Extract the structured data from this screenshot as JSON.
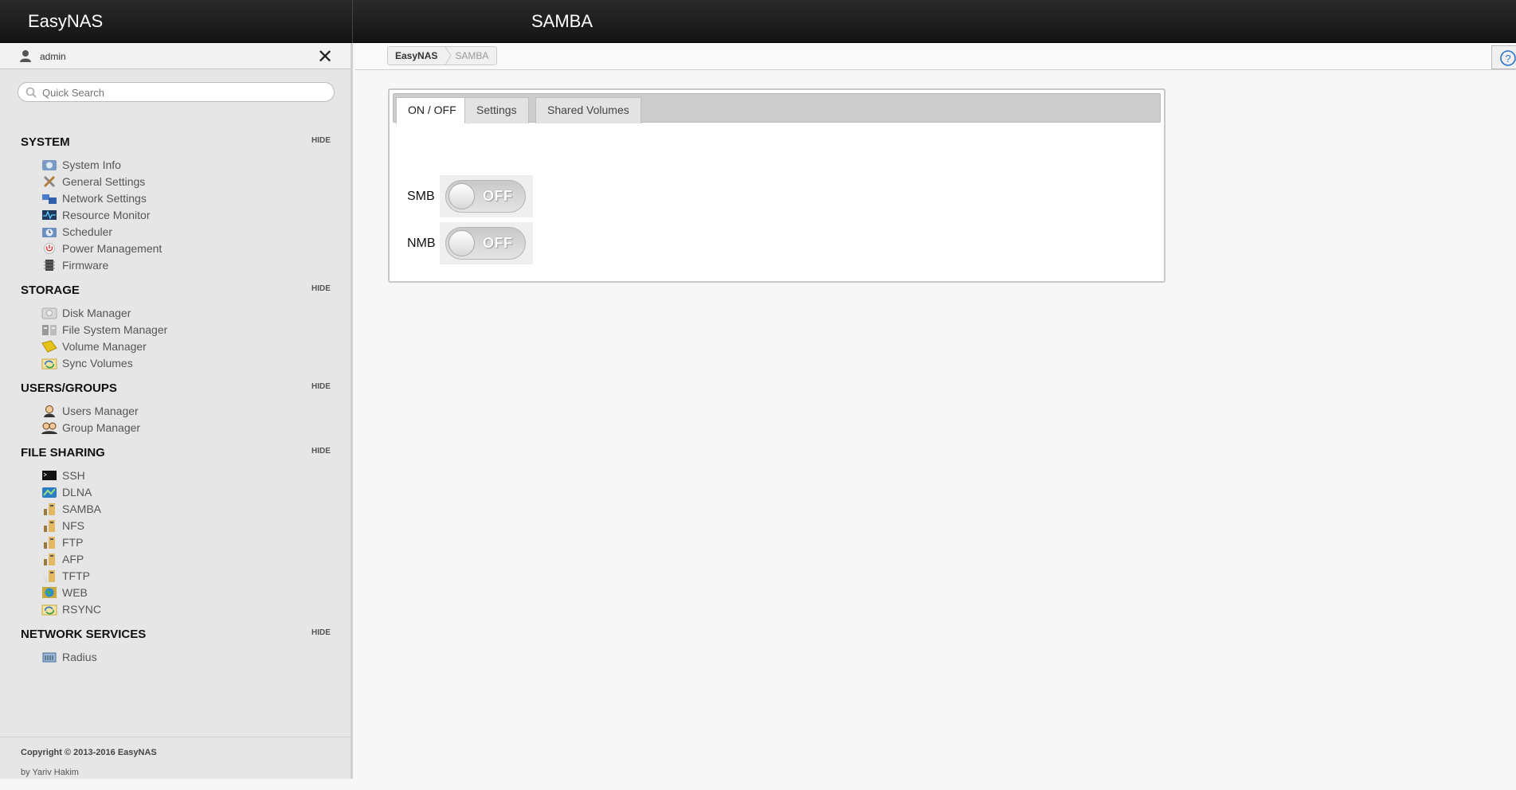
{
  "app": {
    "brand": "EasyNAS",
    "page_title": "SAMBA"
  },
  "user": {
    "name": "admin"
  },
  "search": {
    "placeholder": "Quick Search"
  },
  "hide_label": "HIDE",
  "sidebar": {
    "system": {
      "title": "SYSTEM",
      "items": [
        {
          "label": "System Info",
          "icon": "info-icon"
        },
        {
          "label": "General Settings",
          "icon": "tools-icon"
        },
        {
          "label": "Network Settings",
          "icon": "network-icon"
        },
        {
          "label": "Resource Monitor",
          "icon": "monitor-icon"
        },
        {
          "label": "Scheduler",
          "icon": "clock-icon"
        },
        {
          "label": "Power Management",
          "icon": "power-icon"
        },
        {
          "label": "Firmware",
          "icon": "chip-icon"
        }
      ]
    },
    "storage": {
      "title": "STORAGE",
      "items": [
        {
          "label": "Disk Manager",
          "icon": "disk-icon"
        },
        {
          "label": "File System Manager",
          "icon": "filesystem-icon"
        },
        {
          "label": "Volume Manager",
          "icon": "volume-icon"
        },
        {
          "label": "Sync Volumes",
          "icon": "sync-icon"
        }
      ]
    },
    "users": {
      "title": "USERS/GROUPS",
      "items": [
        {
          "label": "Users Manager",
          "icon": "user-icon"
        },
        {
          "label": "Group Manager",
          "icon": "group-icon"
        }
      ]
    },
    "sharing": {
      "title": "FILE SHARING",
      "items": [
        {
          "label": "SSH",
          "icon": "terminal-icon"
        },
        {
          "label": "DLNA",
          "icon": "dlna-icon"
        },
        {
          "label": "SAMBA",
          "icon": "share-icon"
        },
        {
          "label": "NFS",
          "icon": "share-icon"
        },
        {
          "label": "FTP",
          "icon": "share-icon"
        },
        {
          "label": "AFP",
          "icon": "share-icon"
        },
        {
          "label": "TFTP",
          "icon": "share-icon"
        },
        {
          "label": "WEB",
          "icon": "globe-icon"
        },
        {
          "label": "RSYNC",
          "icon": "sync-icon"
        }
      ]
    },
    "netservices": {
      "title": "NETWORK SERVICES",
      "items": [
        {
          "label": "Radius",
          "icon": "radius-icon"
        }
      ]
    }
  },
  "footer": {
    "copyright": "Copyright © 2013-2016 EasyNAS",
    "author": "by Yariv Hakim"
  },
  "breadcrumb": {
    "home": "EasyNAS",
    "current": "SAMBA"
  },
  "tabs": [
    {
      "label": "ON / OFF"
    },
    {
      "label": "Settings"
    },
    {
      "label": "Shared Volumes"
    }
  ],
  "toggles": [
    {
      "label": "SMB",
      "state": "OFF"
    },
    {
      "label": "NMB",
      "state": "OFF"
    }
  ]
}
